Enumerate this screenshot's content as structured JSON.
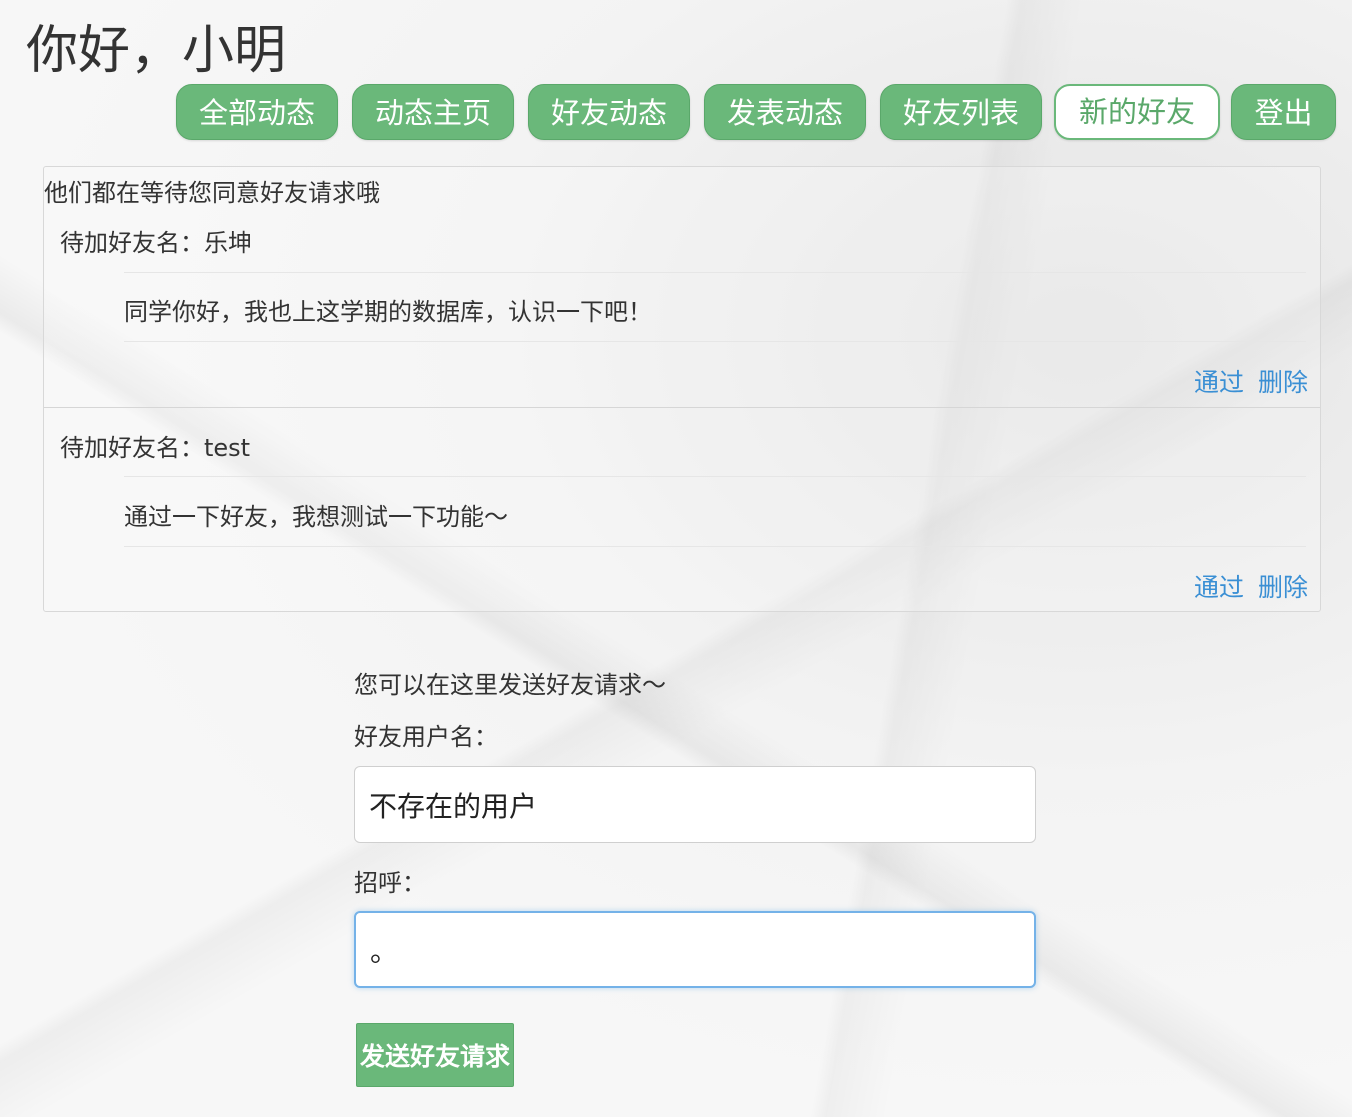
{
  "header": {
    "greeting": "你好，小明"
  },
  "nav": {
    "items": [
      {
        "label": "全部动态"
      },
      {
        "label": "动态主页"
      },
      {
        "label": "好友动态"
      },
      {
        "label": "发表动态"
      },
      {
        "label": "好友列表"
      },
      {
        "label": "新的好友",
        "active": true
      },
      {
        "label": "登出"
      }
    ]
  },
  "pending": {
    "title": "他们都在等待您同意好友请求哦",
    "requests": [
      {
        "name_line": "待加好友名：乐坤",
        "message": "同学你好，我也上这学期的数据库，认识一下吧！",
        "approve": "通过",
        "delete": "删除"
      },
      {
        "name_line": "待加好友名：test",
        "message": "通过一下好友，我想测试一下功能～",
        "approve": "通过",
        "delete": "删除"
      }
    ]
  },
  "send_form": {
    "hint": "您可以在这里发送好友请求～",
    "username_label": "好友用户名：",
    "username_value": "不存在的用户",
    "greeting_label": "招呼：",
    "greeting_value": "。",
    "submit_label": "发送好友请求"
  },
  "colors": {
    "accent_green": "#6ab87a",
    "link_blue": "#3a8fd4",
    "focus_blue": "#74b2e8"
  }
}
